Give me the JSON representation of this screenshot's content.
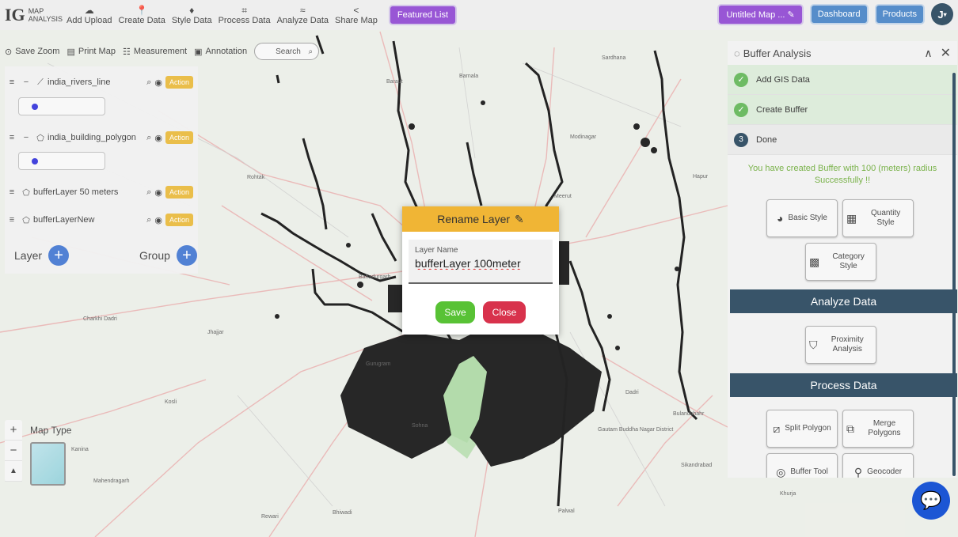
{
  "header": {
    "logo_main": "IG",
    "logo_text_1": "MAP",
    "logo_text_2": "ANALYSIS",
    "nav": [
      {
        "label": "Add Upload",
        "icon": "cloud-upload-icon"
      },
      {
        "label": "Create Data",
        "icon": "map-pin-icon"
      },
      {
        "label": "Style Data",
        "icon": "paint-bucket-icon"
      },
      {
        "label": "Process Data",
        "icon": "process-icon"
      },
      {
        "label": "Analyze Data",
        "icon": "analyze-icon"
      },
      {
        "label": "Share Map",
        "icon": "share-icon"
      }
    ],
    "featured_label": "Featured List",
    "map_title": "Untitled Map ...",
    "dashboard_label": "Dashboard",
    "products_label": "Products",
    "avatar_letter": "J"
  },
  "map_toolbar": {
    "save_zoom": "Save Zoom",
    "print_map": "Print Map",
    "measurement": "Measurement",
    "annotation": "Annotation",
    "search_placeholder": "Search"
  },
  "layers": {
    "items": [
      {
        "name": "india_rivers_line",
        "action": "Action"
      },
      {
        "name": "india_building_polygon",
        "action": "Action"
      },
      {
        "name": "bufferLayer 50 meters",
        "action": "Action"
      },
      {
        "name": "bufferLayerNew",
        "action": "Action"
      }
    ],
    "layer_label": "Layer",
    "group_label": "Group",
    "swatch_color": "#2a2ad8"
  },
  "buffer_panel": {
    "title": "Buffer Analysis",
    "steps": [
      {
        "label": "Add GIS Data",
        "state": "done"
      },
      {
        "label": "Create Buffer",
        "state": "done"
      },
      {
        "label": "Done",
        "number": "3",
        "state": "current"
      }
    ],
    "success_line1": "You have created Buffer with 100 (meters) radius",
    "success_line2": "Successfully !!",
    "style_buttons": [
      {
        "label": "Basic Style",
        "icon": "globe-icon"
      },
      {
        "label": "Quantity Style",
        "icon": "quantity-icon"
      },
      {
        "label": "Category Style",
        "icon": "category-icon"
      }
    ],
    "analyze_heading": "Analyze Data",
    "analyze_buttons": [
      {
        "label": "Proximity Analysis",
        "icon": "proximity-icon"
      }
    ],
    "process_heading": "Process Data",
    "process_buttons": [
      {
        "label": "Split Polygon",
        "icon": "split-icon"
      },
      {
        "label": "Merge Polygons",
        "icon": "merge-icon"
      },
      {
        "label": "Buffer Tool",
        "icon": "buffer-icon"
      },
      {
        "label": "Geocoder",
        "icon": "geocoder-icon"
      }
    ]
  },
  "map_type": {
    "label": "Map Type",
    "zoom_in": "+",
    "zoom_out": "−",
    "reset": "▲"
  },
  "modal": {
    "title": "Rename Layer",
    "field_label": "Layer Name",
    "field_value": "bufferLayer 100meter",
    "save_label": "Save",
    "close_label": "Close"
  },
  "map_labels": {
    "places": [
      "Barnala",
      "Baraut",
      "Rohtak",
      "Bahadurgarh",
      "Charkhi Dadri",
      "Jhajjar",
      "Rewari",
      "Bhiwadi",
      "Sohna",
      "Palwal",
      "Hapur",
      "Sardhana",
      "Modinagar",
      "Bulandshahr",
      "Dadri",
      "Kosli",
      "Kanina",
      "Mahendragarh",
      "Sikandrabad",
      "Khurja",
      "Gurugram",
      "Gautam Buddha Nagar District",
      "Meerut"
    ]
  },
  "colors": {
    "accent_purple": "#8a3fd0",
    "nav_blue": "#3f7ec3",
    "navy": "#1d3d55",
    "modal_header": "#f0b535",
    "save_green": "#58c235",
    "close_red": "#d8324c",
    "action_yellow": "#e8b632"
  }
}
